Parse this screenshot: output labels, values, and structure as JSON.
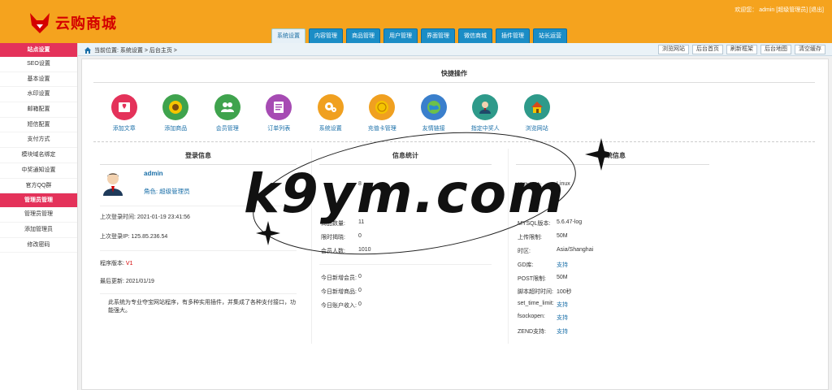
{
  "header": {
    "logo_text": "云购商城",
    "welcome_prefix": "欢迎您：",
    "welcome_user": "admin [超级管理员]",
    "logout": "[退出]"
  },
  "nav": {
    "tabs": [
      "系统设置",
      "内容管理",
      "商品管理",
      "用户管理",
      "界面管理",
      "微信商城",
      "插件管理",
      "站长运营"
    ]
  },
  "sidebar": {
    "group1": "站点设置",
    "items1": [
      "SEO设置",
      "基本设置",
      "水印设置",
      "邮箱配置",
      "短信配置",
      "支付方式",
      "模块域名绑定",
      "中奖通知设置",
      "官方QQ群"
    ],
    "group2": "管理员管理",
    "items2": [
      "管理员管理",
      "添加管理员",
      "修改密码"
    ]
  },
  "breadcrumb": {
    "text": "当前位置: 系统设置 > 后台主页 >",
    "buttons": [
      "浏览网站",
      "后台首页",
      "刷新框架",
      "后台地图",
      "清空缓存"
    ]
  },
  "quick": {
    "title": "快捷操作",
    "items": [
      {
        "label": "添加文章",
        "color": "#e4325a",
        "icon": "book-icon"
      },
      {
        "label": "添加商品",
        "color": "#3fa34d",
        "icon": "sunflower-icon"
      },
      {
        "label": "会员管理",
        "color": "#3fa34d",
        "icon": "users-icon"
      },
      {
        "label": "订单列表",
        "color": "#a64bb3",
        "icon": "list-icon"
      },
      {
        "label": "系统设置",
        "color": "#f0a020",
        "icon": "gear-icon"
      },
      {
        "label": "充值卡管理",
        "color": "#f0a020",
        "icon": "coin-icon"
      },
      {
        "label": "友情链接",
        "color": "#3a7fcc",
        "icon": "globe-icon"
      },
      {
        "label": "指定中奖人",
        "color": "#2e9a8a",
        "icon": "person-icon"
      },
      {
        "label": "浏览网站",
        "color": "#2e9a8a",
        "icon": "house-icon"
      }
    ]
  },
  "login": {
    "title": "登录信息",
    "username": "admin",
    "role": "角色: 超级管理员",
    "last_time": "上次登录时间: 2021-01-19 23:41:56",
    "last_ip": "上次登录IP: 125.85.236.54",
    "version_label": "程序版本:",
    "version": "V1",
    "updated": "最后更新: 2021/01/19",
    "desc": "此系统为专业夺宝网站程序，有多种实用插件，并集成了各种支付接口，功能强大。"
  },
  "stats": {
    "title": "信息统计",
    "rows": [
      {
        "label": "",
        "value": "8"
      },
      {
        "label": "商品数量:",
        "value": "11"
      },
      {
        "label": "限时揭晓:",
        "value": "0"
      },
      {
        "label": "会员人数:",
        "value": "1010"
      },
      {
        "label": "今日新增会员:",
        "value": "0"
      },
      {
        "label": "今日新增商品:",
        "value": "0"
      },
      {
        "label": "今日账户收入:",
        "value": "0"
      }
    ]
  },
  "system": {
    "title": "系统信息",
    "rows": [
      {
        "label": "操作系统:",
        "value": "Linux"
      },
      {
        "label": "MYSQL版本:",
        "value": "5.6.47-log"
      },
      {
        "label": "上传限制:",
        "value": "50M"
      },
      {
        "label": "时区:",
        "value": "Asia/Shanghai"
      },
      {
        "label": "GD库:",
        "value": "支持"
      },
      {
        "label": "POST限制:",
        "value": "50M"
      },
      {
        "label": "脚本超时时间:",
        "value": "100秒"
      },
      {
        "label": "set_time_limit:",
        "value": "支持"
      },
      {
        "label": "fsockopen:",
        "value": "支持"
      },
      {
        "label": "ZEND支持:",
        "value": "支持"
      }
    ]
  },
  "watermark": "k9ym.com"
}
